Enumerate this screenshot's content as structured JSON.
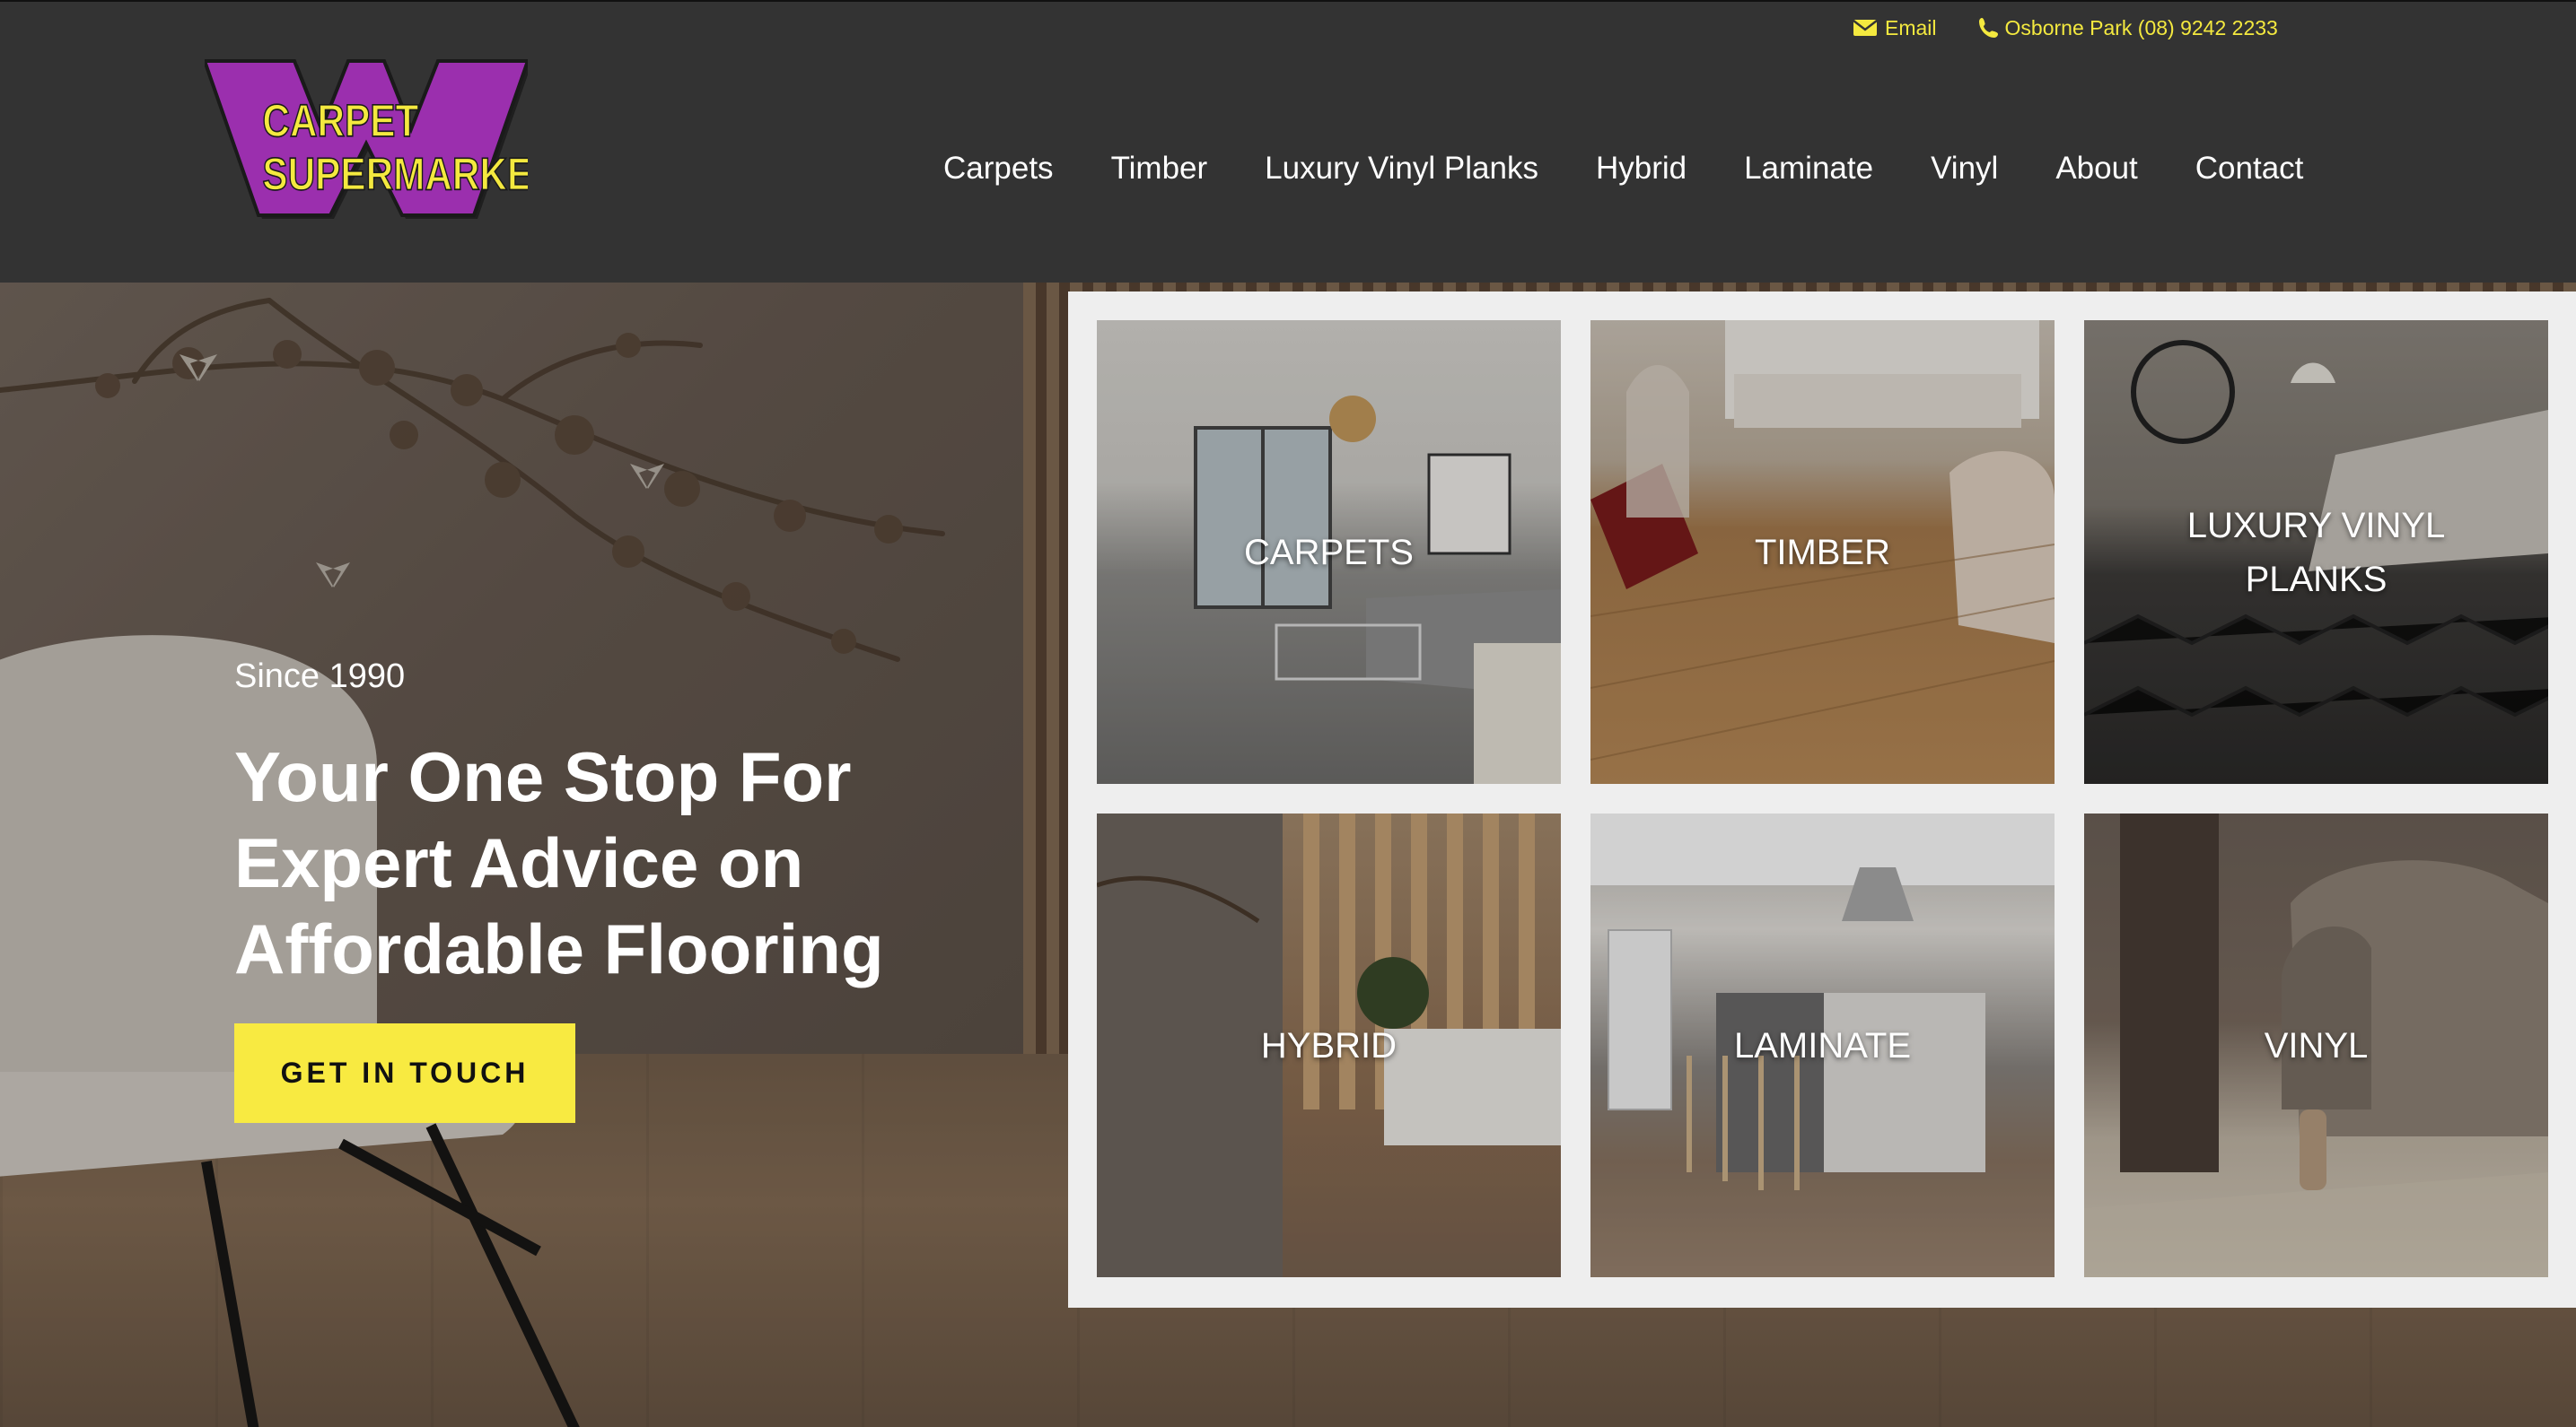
{
  "header": {
    "topbar": {
      "email_label": "Email",
      "phone_label": "Osborne Park (08) 9242 2233"
    },
    "logo": {
      "line1": "CARPET",
      "line2": "SUPERMARKET",
      "colors": {
        "purple": "#9b2fae",
        "yellow": "#f4e93f"
      }
    },
    "nav": [
      {
        "label": "Carpets"
      },
      {
        "label": "Timber"
      },
      {
        "label": "Luxury Vinyl Planks"
      },
      {
        "label": "Hybrid"
      },
      {
        "label": "Laminate"
      },
      {
        "label": "Vinyl"
      },
      {
        "label": "About"
      },
      {
        "label": "Contact"
      }
    ]
  },
  "hero": {
    "since": "Since 1990",
    "headline_line1": "Your One Stop For",
    "headline_line2": "Expert Advice on",
    "headline_line3": "Affordable Flooring",
    "cta_label": "GET IN TOUCH",
    "cta_color": "#f8ea41"
  },
  "categories": [
    {
      "label": "CARPETS"
    },
    {
      "label": "TIMBER"
    },
    {
      "label": "LUXURY VINYL PLANKS"
    },
    {
      "label": "HYBRID"
    },
    {
      "label": "LAMINATE"
    },
    {
      "label": "VINYL"
    }
  ],
  "icons": {
    "email": "envelope-icon",
    "phone": "phone-icon"
  }
}
